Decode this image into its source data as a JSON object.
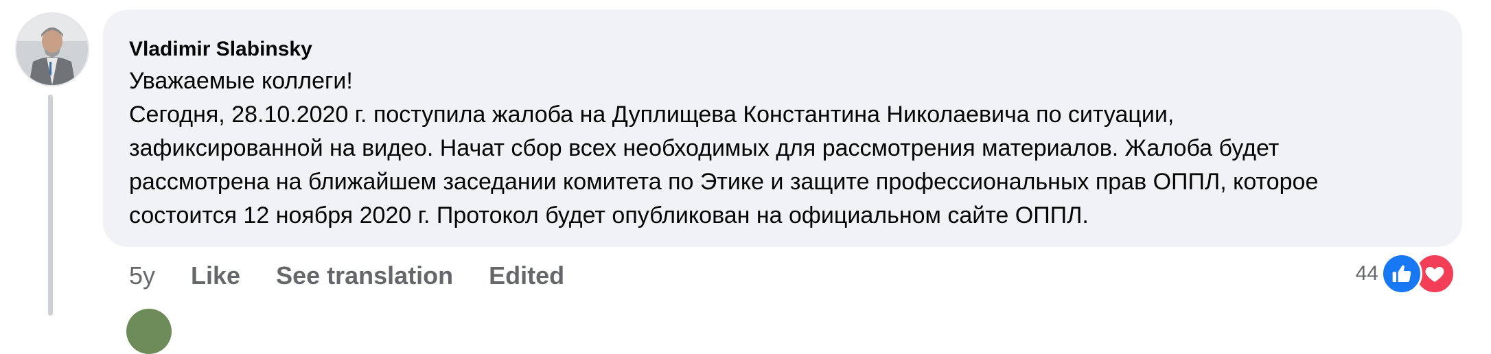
{
  "comment": {
    "author": "Vladimir Slabinsky",
    "lines": [
      "Уважаемые коллеги!",
      "Сегодня, 28.10.2020 г. поступила жалоба на Дуплищева Константина Николаевича по ситуации,",
      "зафиксированной на видео. Начат сбор всех необходимых для рассмотрения материалов. Жалоба будет",
      "рассмотрена на ближайшем заседании комитета по Этике и защите профессиональных прав ОППЛ, которое",
      "состоится 12 ноября 2020 г. Протокол будет опубликован на официальном сайте ОППЛ."
    ],
    "time": "5y",
    "like_label": "Like",
    "translate_label": "See translation",
    "edited_label": "Edited",
    "reaction_count": "44",
    "reaction_icons": [
      "like-icon",
      "love-icon"
    ]
  },
  "colors": {
    "bubble": "#f0f2f5",
    "secondary_text": "#65676b",
    "like_blue": "#1877f2",
    "love_red": "#f33e58"
  }
}
